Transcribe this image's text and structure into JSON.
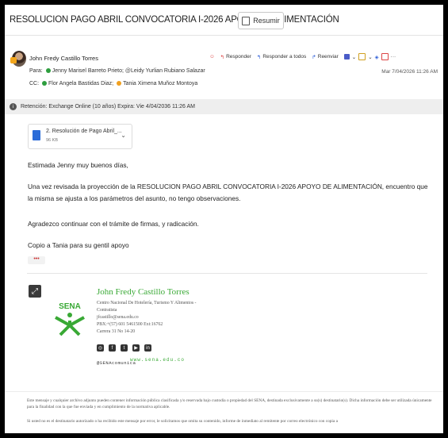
{
  "email": {
    "subject": "RESOLUCION  PAGO ABRIL CONVOCATORIA I-2026 APOYO DE ALIMENTACIÓN",
    "summarize_label": "Resumir",
    "sender": "John Fredy Castillo Torres",
    "to_label": "Para:",
    "to_recipients": [
      "Jenny Marisel Barreto Prieto;",
      "Leidy Yurlian Rubiano Salazar"
    ],
    "cc_label": "CC:",
    "cc_recipients": [
      "Flor Angela Bastidas Diaz;",
      "Tania Ximena Muñoz Montoya"
    ],
    "date": "Mar 7/04/2026 11:26 AM",
    "actions": {
      "reply": "Responder",
      "reply_all": "Responder a todos",
      "forward": "Reenviar"
    },
    "retention": "Retención: Exchange Online (10 años) Expira: Vie 4/04/2036 11:26 AM",
    "attachment": {
      "name": "2. Resolución de Pago Abril_...",
      "size": "96 KB"
    },
    "body": {
      "greeting": "Estimada Jenny muy buenos días,",
      "paragraph": "Una vez revisada la proyección de la RESOLUCION PAGO ABRIL CONVOCATORIA I-2026 APOYO DE ALIMENTACIÓN, encuentro que la misma se ajusta a los parámetros del asunto, no tengo observaciones.",
      "thanks": "Agradezco continuar con el trámite de firmas, y radicación.",
      "copy": "Copio a Tania para su gentil apoyo",
      "ellipsis": "•••"
    },
    "signature": {
      "logo_text": "SENA",
      "name": "John Fredy Castillo Torres",
      "org_line1": "Centro Nacional De Hotelería, Turismo Y Alimentos -",
      "org_line2": "Contratista",
      "email": "jfcastillo@sena.edu.co",
      "phone": "PBX:+(57) 601 5461500 Ext:16762",
      "address": "Carrera 31 No 14-20",
      "handle": "@SENAcomunica",
      "website": "www.sena.edu.co"
    },
    "disclaimer": {
      "p1": "Este mensaje y cualquier archivo adjunto pueden contener información pública clasificada y/o reservada bajo custodia o propiedad del SENA, destinada exclusivamente a su(s) destinatario(s). Dicha información debe ser utilizada únicamente para la finalidad con la que fue enviada y en cumplimiento de la normativa aplicable.",
      "p2": "Si usted no es el destinatario autorizado o ha recibido este mensaje por error, le solicitamos que omita su contenido, informe de inmediato al remitente por correo electrónico con copia a"
    }
  },
  "colors": {
    "sena_green": "#39a935",
    "accent_blue": "#2a5bd7"
  }
}
